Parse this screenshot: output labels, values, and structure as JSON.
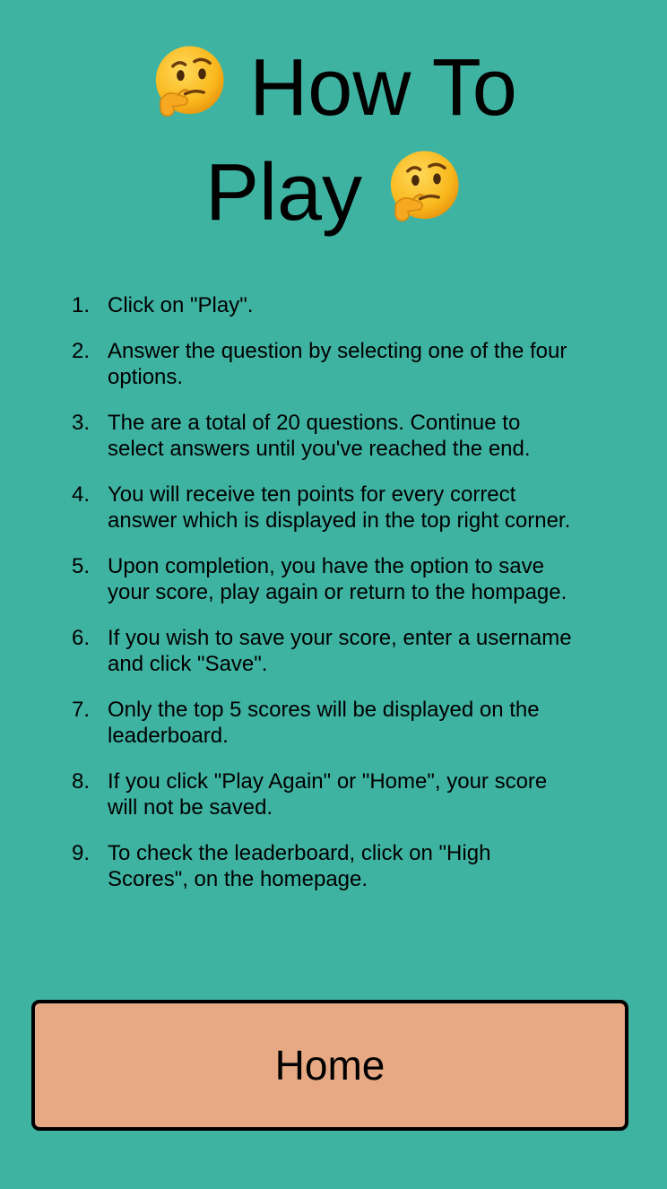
{
  "title": {
    "line1": "How To",
    "line2": "Play",
    "icon": "thinking-face-emoji"
  },
  "steps": [
    {
      "num": "1.",
      "text": "Click on \"Play\"."
    },
    {
      "num": "2.",
      "text": "Answer the question by selecting one of the four options."
    },
    {
      "num": "3.",
      "text": "The are a total of 20 questions. Continue to select answers until you've reached the end."
    },
    {
      "num": "4.",
      "text": "You will receive ten points for every correct answer which is displayed in the top right corner."
    },
    {
      "num": "5.",
      "text": "Upon completion, you have the option to save your score, play again or return to the hompage."
    },
    {
      "num": "6.",
      "text": "If you wish to save your score, enter a username and click \"Save\"."
    },
    {
      "num": "7.",
      "text": "Only the top 5 scores will be displayed on the leaderboard."
    },
    {
      "num": "8.",
      "text": "If you click \"Play Again\" or \"Home\", your score will not be saved."
    },
    {
      "num": "9.",
      "text": "To check the leaderboard, click on \"High Scores\", on the homepage."
    }
  ],
  "home_button": {
    "label": "Home"
  },
  "colors": {
    "background": "#3fb3a2",
    "button": "#e6a983",
    "text": "#000000"
  }
}
